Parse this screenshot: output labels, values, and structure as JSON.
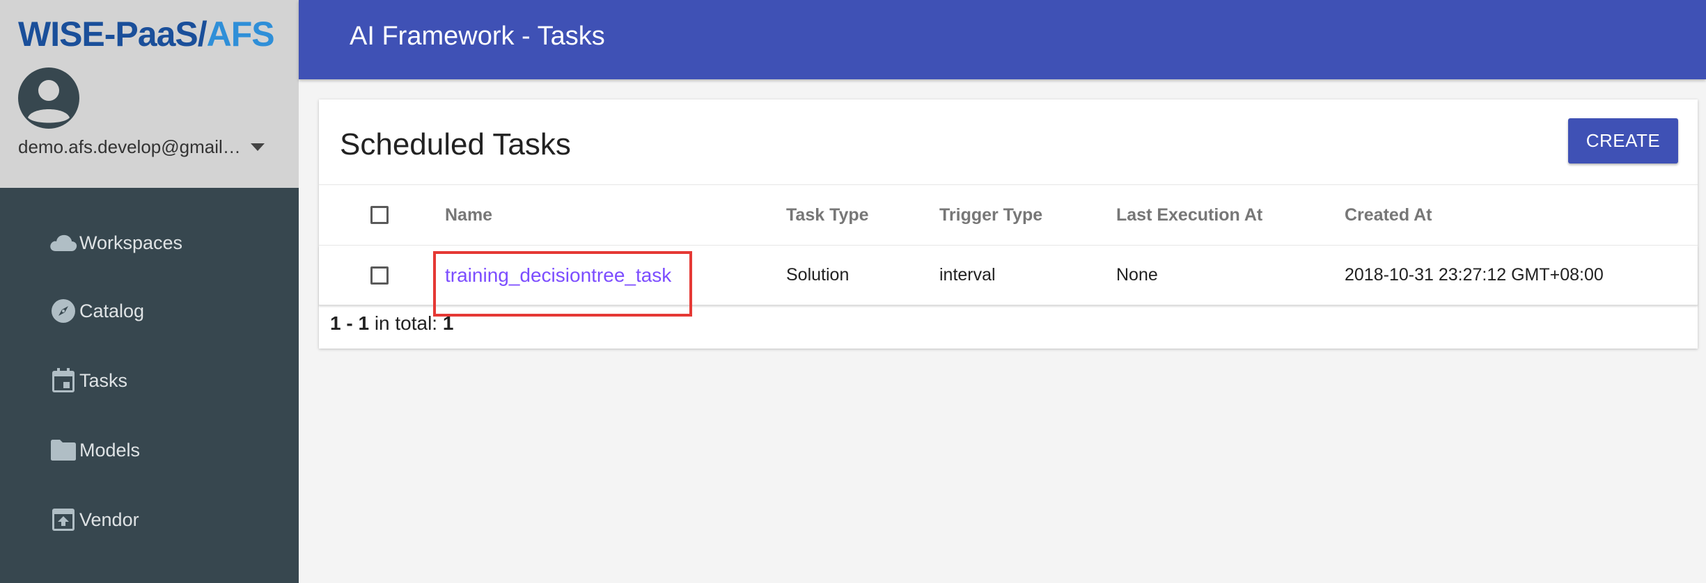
{
  "brand": {
    "part1": "WISE-PaaS/",
    "part2": "AFS"
  },
  "user": {
    "email": "demo.afs.develop@gmail.com"
  },
  "nav": {
    "items": [
      {
        "label": "Workspaces",
        "icon": "cloud-icon"
      },
      {
        "label": "Catalog",
        "icon": "compass-icon"
      },
      {
        "label": "Tasks",
        "icon": "calendar-icon"
      },
      {
        "label": "Models",
        "icon": "folder-icon"
      },
      {
        "label": "Vendor",
        "icon": "archive-icon"
      }
    ]
  },
  "header": {
    "title": "AI Framework - Tasks"
  },
  "card": {
    "title": "Scheduled Tasks",
    "create_label": "CREATE"
  },
  "table": {
    "columns": {
      "name": "Name",
      "task_type": "Task Type",
      "trigger_type": "Trigger Type",
      "last_execution": "Last Execution At",
      "created_at": "Created At"
    },
    "rows": [
      {
        "name": "training_decisiontree_task",
        "task_type": "Solution",
        "trigger_type": "interval",
        "last_execution": "None",
        "created_at": "2018-10-31 23:27:12 GMT+08:00"
      }
    ]
  },
  "pagination": {
    "range": "1 - 1",
    "in_total_label": "in total:",
    "total": "1"
  },
  "colors": {
    "header_bg": "#3f51b5",
    "sidebar_bg": "#37474f",
    "sidebar_head_bg": "#d3d3d3",
    "link": "#7c4dff",
    "highlight": "#e53935"
  }
}
